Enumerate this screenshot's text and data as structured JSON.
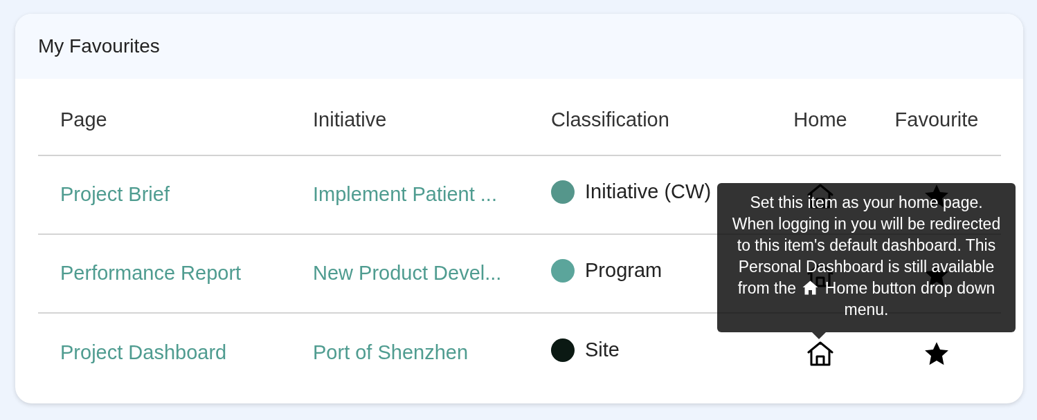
{
  "card": {
    "title": "My Favourites"
  },
  "table": {
    "columns": [
      "Page",
      "Initiative",
      "Classification",
      "Home",
      "Favourite"
    ],
    "rows": [
      {
        "page": "Project Brief",
        "initiative": "Implement Patient ...",
        "classification": "Initiative (CW)",
        "color": "#55968b",
        "home": false,
        "favourite": true
      },
      {
        "page": "Performance Report",
        "initiative": "New Product Devel...",
        "classification": "Program",
        "color": "#5ba59b",
        "home": false,
        "favourite": true
      },
      {
        "page": "Project Dashboard",
        "initiative": "Port of Shenzhen",
        "classification": "Site",
        "color": "#0b1913",
        "home": false,
        "favourite": true
      }
    ]
  },
  "tooltip": {
    "text": "Set this item as your home page. When logging in you will be redirected to this item's default dashboard. This Personal Dashboard is still available",
    "before_icon": "from the",
    "after_icon": "Home button drop down menu."
  }
}
